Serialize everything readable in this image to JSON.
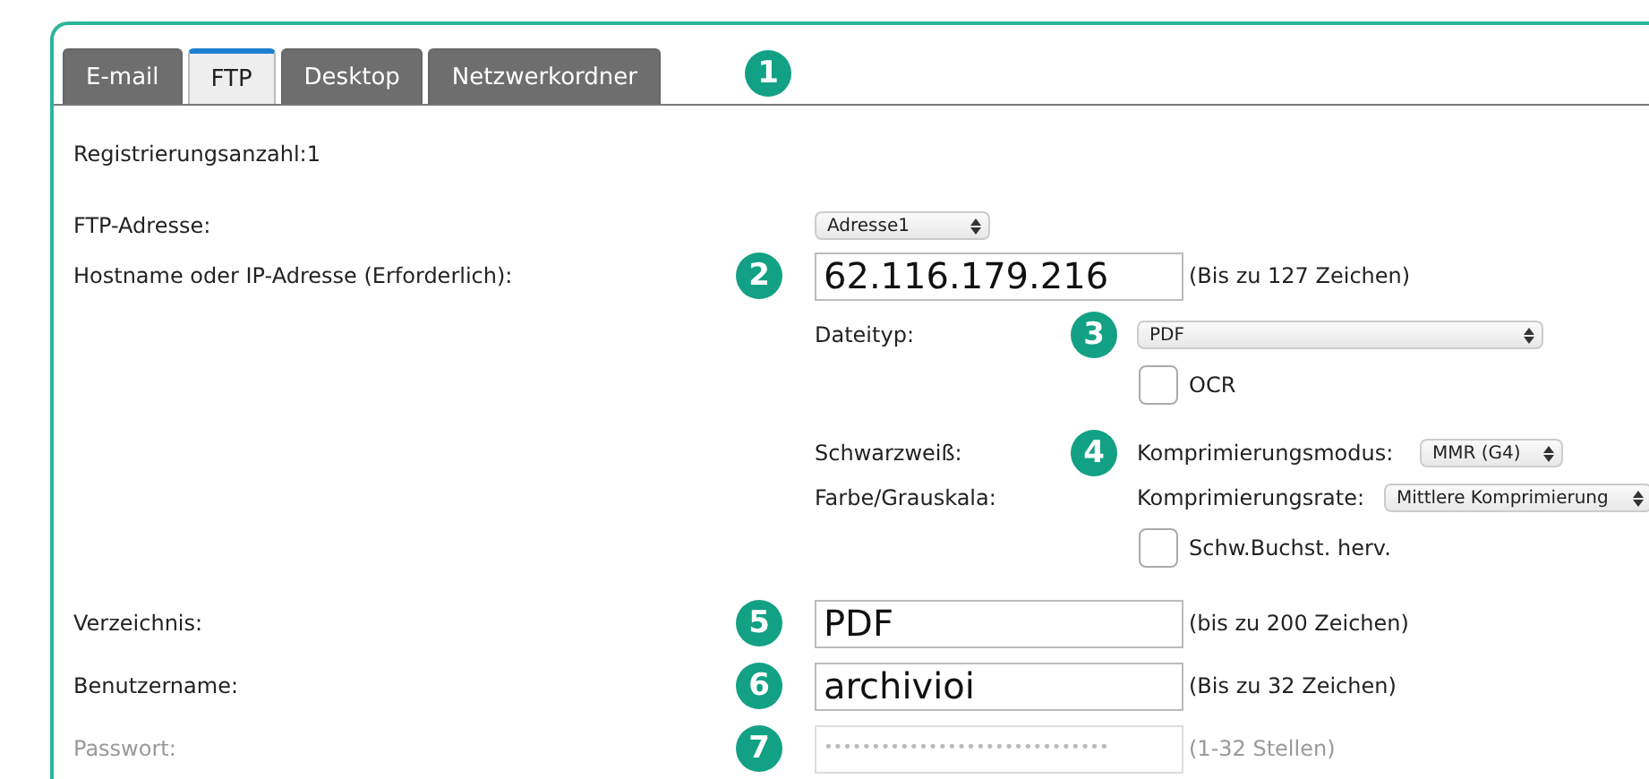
{
  "tabs": [
    {
      "label": "E-mail",
      "selected": false
    },
    {
      "label": "FTP",
      "selected": true
    },
    {
      "label": "Desktop",
      "selected": false
    },
    {
      "label": "Netzwerkordner",
      "selected": false
    }
  ],
  "tab_badge": "1",
  "registration_count": "Registrierungsanzahl:1",
  "ftp_address": {
    "label": "FTP-Adresse:",
    "value": "Adresse1"
  },
  "hostname": {
    "label": "Hostname oder IP-Adresse (Erforderlich):",
    "badge": "2",
    "value": "62.116.179.216",
    "hint": "(Bis zu 127 Zeichen)"
  },
  "file_type": {
    "label": "Dateityp:",
    "badge": "3",
    "value": "PDF"
  },
  "ocr": {
    "label": "OCR",
    "checked": false
  },
  "black_white": {
    "label": "Schwarzweiß:",
    "badge": "4",
    "setting": "Komprimierungsmodus:",
    "value": "MMR (G4)"
  },
  "color_gray": {
    "label": "Farbe/Grauskala:",
    "setting": "Komprimierungsrate:",
    "value": "Mittlere Komprimierung"
  },
  "highlight": {
    "label": "Schw.Buchst. herv.",
    "checked": false
  },
  "fields": [
    {
      "label": "Verzeichnis:",
      "badge": "5",
      "value": "PDF",
      "hint": "(bis zu 200 Zeichen)",
      "disabled": false
    },
    {
      "label": "Benutzername:",
      "badge": "6",
      "value": "archivioi",
      "hint": "(Bis zu 32 Zeichen)",
      "disabled": false
    },
    {
      "label": "Passwort:",
      "badge": "7",
      "value": "••••••••••••••••••••••••••••••",
      "hint": "(1-32 Stellen)",
      "disabled": true
    }
  ]
}
